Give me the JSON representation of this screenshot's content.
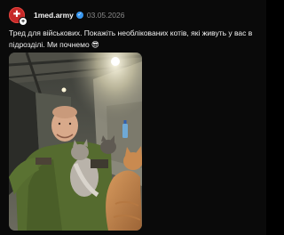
{
  "post": {
    "username": "1med.army",
    "date": "03.05.2026",
    "text": "Тред для військових. Покажіть необлікованих котів, які живуть у вас в підрозділі. Ми почнемо 😎",
    "avatar_icon": "medical-cross-logo",
    "verified_icon": "verified-badge-icon"
  },
  "colors": {
    "background": "#0a0a0a",
    "text": "#f1f1f1",
    "muted": "#8a8a8a",
    "avatar": "#c62828",
    "verified": "#3897f0"
  }
}
